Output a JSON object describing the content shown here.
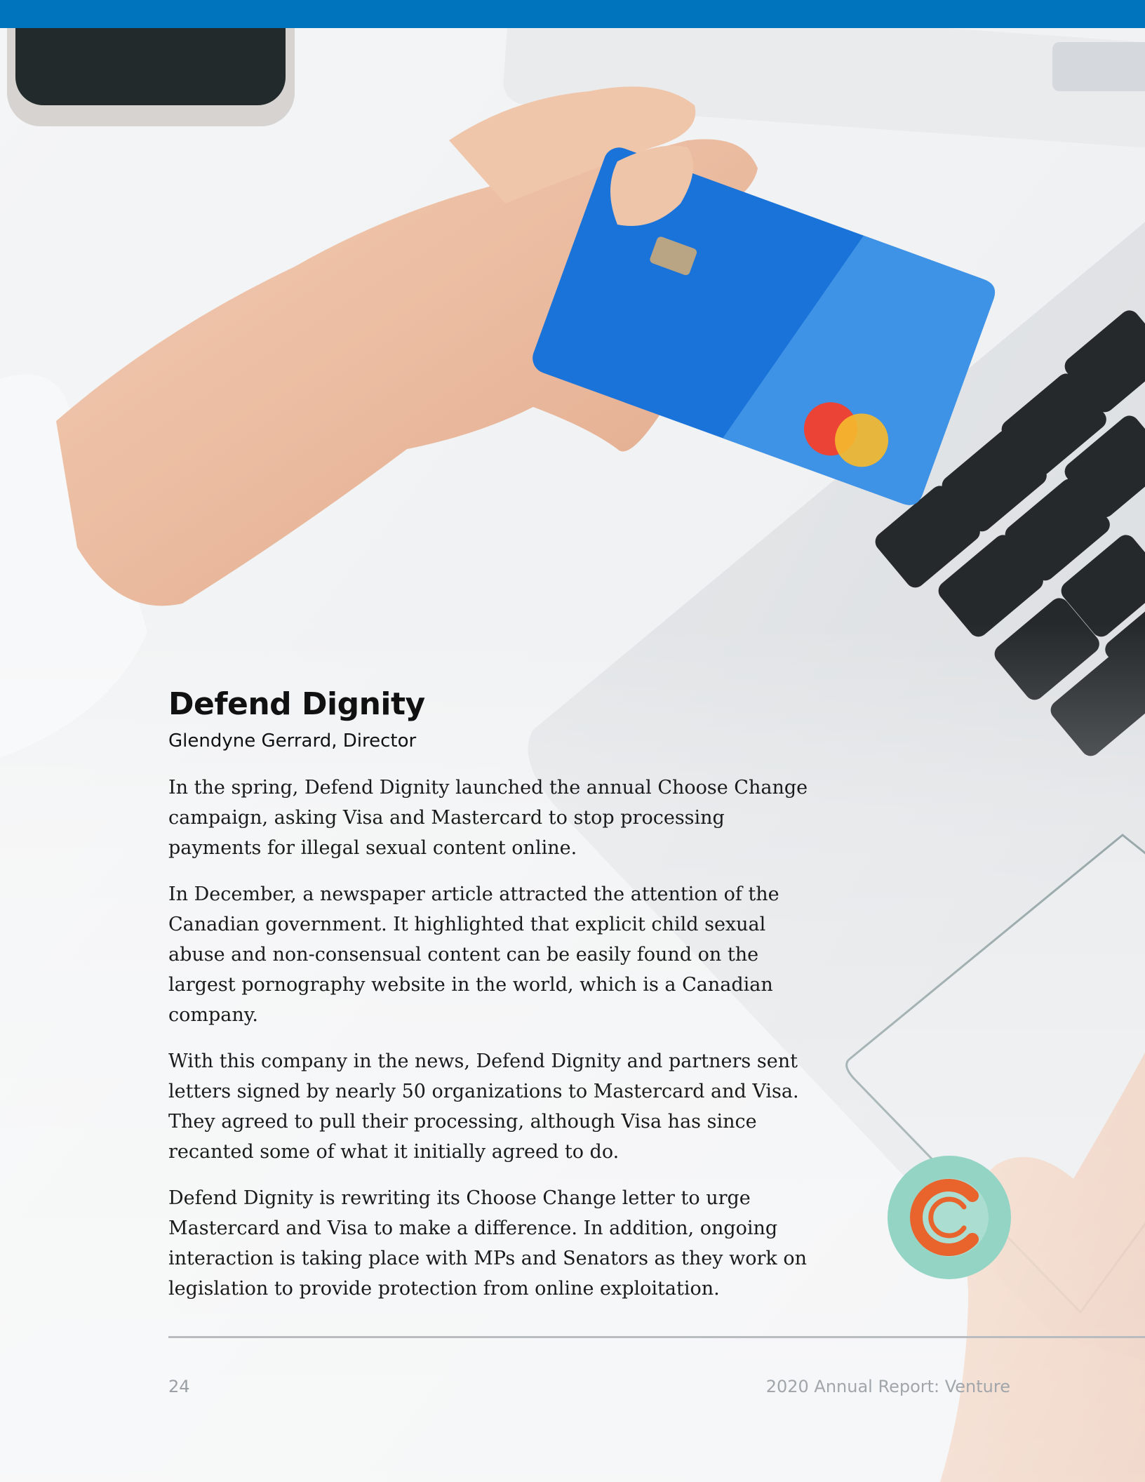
{
  "header": {
    "bar_color": "#0174be"
  },
  "background_photo": {
    "card_color": "#1a73d9",
    "card_panel_color": "#3f93e6",
    "mastercard_red": "#eb4335",
    "mastercard_yellow": "#f5b82e"
  },
  "article": {
    "title": "Defend Dignity",
    "byline": "Glendyne Gerrard, Director",
    "paragraphs": [
      "In the spring, Defend Dignity launched the annual Choose Change campaign, asking Visa and Mastercard to stop processing payments for illegal sexual content online.",
      "In December, a newspaper article attracted the attention of the Canadian government. It highlighted that explicit child sexual abuse and non-consensual content can be easily found on the largest pornography website in the world, which is a Canadian company.",
      "With this company in the news, Defend Dignity and partners sent letters signed by nearly 50 organizations to Mastercard and Visa. They agreed to pull their processing, although Visa has since recanted some of what it initially agreed to do.",
      "Defend Dignity is rewriting its Choose Change letter to urge Mastercard and Visa to make a difference. In addition, ongoing interaction is taking place with MPs and Senators as they work on legislation to provide protection from online exploitation."
    ]
  },
  "logo": {
    "icon": "choose-change-c-logo",
    "ring_color": "#93d4c4",
    "c_color": "#e8642c"
  },
  "footer": {
    "page_number": "24",
    "report_title": "2020 Annual Report: Venture"
  }
}
